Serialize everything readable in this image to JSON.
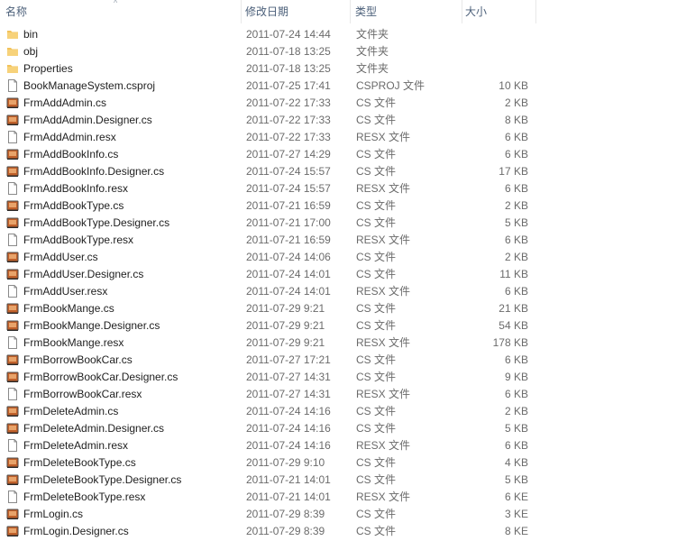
{
  "columns": {
    "name": "名称",
    "date": "修改日期",
    "type": "类型",
    "size": "大小",
    "sort_indicator": "^"
  },
  "files": [
    {
      "name": "bin",
      "date": "2011-07-24 14:44",
      "type": "文件夹",
      "size": "",
      "icon": "folder-icon"
    },
    {
      "name": "obj",
      "date": "2011-07-18 13:25",
      "type": "文件夹",
      "size": "",
      "icon": "folder-icon"
    },
    {
      "name": "Properties",
      "date": "2011-07-18 13:25",
      "type": "文件夹",
      "size": "",
      "icon": "folder-icon"
    },
    {
      "name": "BookManageSystem.csproj",
      "date": "2011-07-25 17:41",
      "type": "CSPROJ 文件",
      "size": "10 KB",
      "icon": "document-icon"
    },
    {
      "name": "FrmAddAdmin.cs",
      "date": "2011-07-22 17:33",
      "type": "CS 文件",
      "size": "2 KB",
      "icon": "cs-file-icon"
    },
    {
      "name": "FrmAddAdmin.Designer.cs",
      "date": "2011-07-22 17:33",
      "type": "CS 文件",
      "size": "8 KB",
      "icon": "cs-file-icon"
    },
    {
      "name": "FrmAddAdmin.resx",
      "date": "2011-07-22 17:33",
      "type": "RESX 文件",
      "size": "6 KB",
      "icon": "document-icon"
    },
    {
      "name": "FrmAddBookInfo.cs",
      "date": "2011-07-27 14:29",
      "type": "CS 文件",
      "size": "6 KB",
      "icon": "cs-file-icon"
    },
    {
      "name": "FrmAddBookInfo.Designer.cs",
      "date": "2011-07-24 15:57",
      "type": "CS 文件",
      "size": "17 KB",
      "icon": "cs-file-icon"
    },
    {
      "name": "FrmAddBookInfo.resx",
      "date": "2011-07-24 15:57",
      "type": "RESX 文件",
      "size": "6 KB",
      "icon": "document-icon"
    },
    {
      "name": "FrmAddBookType.cs",
      "date": "2011-07-21 16:59",
      "type": "CS 文件",
      "size": "2 KB",
      "icon": "cs-file-icon"
    },
    {
      "name": "FrmAddBookType.Designer.cs",
      "date": "2011-07-21 17:00",
      "type": "CS 文件",
      "size": "5 KB",
      "icon": "cs-file-icon"
    },
    {
      "name": "FrmAddBookType.resx",
      "date": "2011-07-21 16:59",
      "type": "RESX 文件",
      "size": "6 KB",
      "icon": "document-icon"
    },
    {
      "name": "FrmAddUser.cs",
      "date": "2011-07-24 14:06",
      "type": "CS 文件",
      "size": "2 KB",
      "icon": "cs-file-icon"
    },
    {
      "name": "FrmAddUser.Designer.cs",
      "date": "2011-07-24 14:01",
      "type": "CS 文件",
      "size": "11 KB",
      "icon": "cs-file-icon"
    },
    {
      "name": "FrmAddUser.resx",
      "date": "2011-07-24 14:01",
      "type": "RESX 文件",
      "size": "6 KB",
      "icon": "document-icon"
    },
    {
      "name": "FrmBookMange.cs",
      "date": "2011-07-29 9:21",
      "type": "CS 文件",
      "size": "21 KB",
      "icon": "cs-file-icon"
    },
    {
      "name": "FrmBookMange.Designer.cs",
      "date": "2011-07-29 9:21",
      "type": "CS 文件",
      "size": "54 KB",
      "icon": "cs-file-icon"
    },
    {
      "name": "FrmBookMange.resx",
      "date": "2011-07-29 9:21",
      "type": "RESX 文件",
      "size": "178 KB",
      "icon": "document-icon"
    },
    {
      "name": "FrmBorrowBookCar.cs",
      "date": "2011-07-27 17:21",
      "type": "CS 文件",
      "size": "6 KB",
      "icon": "cs-file-icon"
    },
    {
      "name": "FrmBorrowBookCar.Designer.cs",
      "date": "2011-07-27 14:31",
      "type": "CS 文件",
      "size": "9 KB",
      "icon": "cs-file-icon"
    },
    {
      "name": "FrmBorrowBookCar.resx",
      "date": "2011-07-27 14:31",
      "type": "RESX 文件",
      "size": "6 KB",
      "icon": "document-icon"
    },
    {
      "name": "FrmDeleteAdmin.cs",
      "date": "2011-07-24 14:16",
      "type": "CS 文件",
      "size": "2 KB",
      "icon": "cs-file-icon"
    },
    {
      "name": "FrmDeleteAdmin.Designer.cs",
      "date": "2011-07-24 14:16",
      "type": "CS 文件",
      "size": "5 KB",
      "icon": "cs-file-icon"
    },
    {
      "name": "FrmDeleteAdmin.resx",
      "date": "2011-07-24 14:16",
      "type": "RESX 文件",
      "size": "6 KB",
      "icon": "document-icon"
    },
    {
      "name": "FrmDeleteBookType.cs",
      "date": "2011-07-29 9:10",
      "type": "CS 文件",
      "size": "4 KB",
      "icon": "cs-file-icon"
    },
    {
      "name": "FrmDeleteBookType.Designer.cs",
      "date": "2011-07-21 14:01",
      "type": "CS 文件",
      "size": "5 KB",
      "icon": "cs-file-icon"
    },
    {
      "name": "FrmDeleteBookType.resx",
      "date": "2011-07-21 14:01",
      "type": "RESX 文件",
      "size": "6 KE",
      "icon": "document-icon"
    },
    {
      "name": "FrmLogin.cs",
      "date": "2011-07-29 8:39",
      "type": "CS 文件",
      "size": "3 KE",
      "icon": "cs-file-icon"
    },
    {
      "name": "FrmLogin.Designer.cs",
      "date": "2011-07-29 8:39",
      "type": "CS 文件",
      "size": "8 KE",
      "icon": "cs-file-icon"
    }
  ],
  "colors": {
    "folder": "#f2c25a",
    "cs_icon": "#b8561f",
    "header_text": "#4c607a"
  }
}
